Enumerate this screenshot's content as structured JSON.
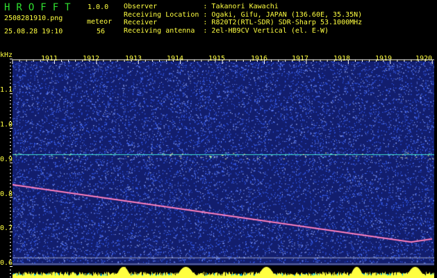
{
  "header": {
    "app_title": "HROFFT",
    "version": "1.0.0",
    "filename": "2508281910.png",
    "datetime": "25.08.28 19:10",
    "meteor_label": "meteor",
    "meteor_count": "56",
    "info_rows": [
      "Observer           : Takanori Kawachi",
      "Receiving Location : Ogaki, Gifu, JAPAN (136.60E, 35.35N)",
      "Receiver           : R820T2(RTL-SDR) SDR-Sharp 53.1000MHz",
      "Receiving antenna  : 2el-HB9CV Vertical (el. E-W)"
    ]
  },
  "chart_data": {
    "type": "heatmap",
    "ylabel": "kHz",
    "y_ticks": [
      "1.1",
      "1.0",
      "0.9",
      "0.8",
      "0.7",
      "0.6"
    ],
    "x_ticks": [
      "1911",
      "1912",
      "1913",
      "1914",
      "1915",
      "1916",
      "1917",
      "1918",
      "1919",
      "1920"
    ],
    "ylim": [
      0.58,
      1.2
    ],
    "carrier_khz": 0.912,
    "drift_trace": {
      "x": [
        1910.0,
        1919.5,
        1920.0
      ],
      "y": [
        0.825,
        0.659,
        0.668
      ]
    },
    "colors": {
      "background": "#121e6e",
      "noise": "#3a64ff",
      "trace": "#ff5aa0",
      "carrier": "#40e0d0",
      "baseline": "#ffff40",
      "power": "#00c8ff"
    }
  }
}
